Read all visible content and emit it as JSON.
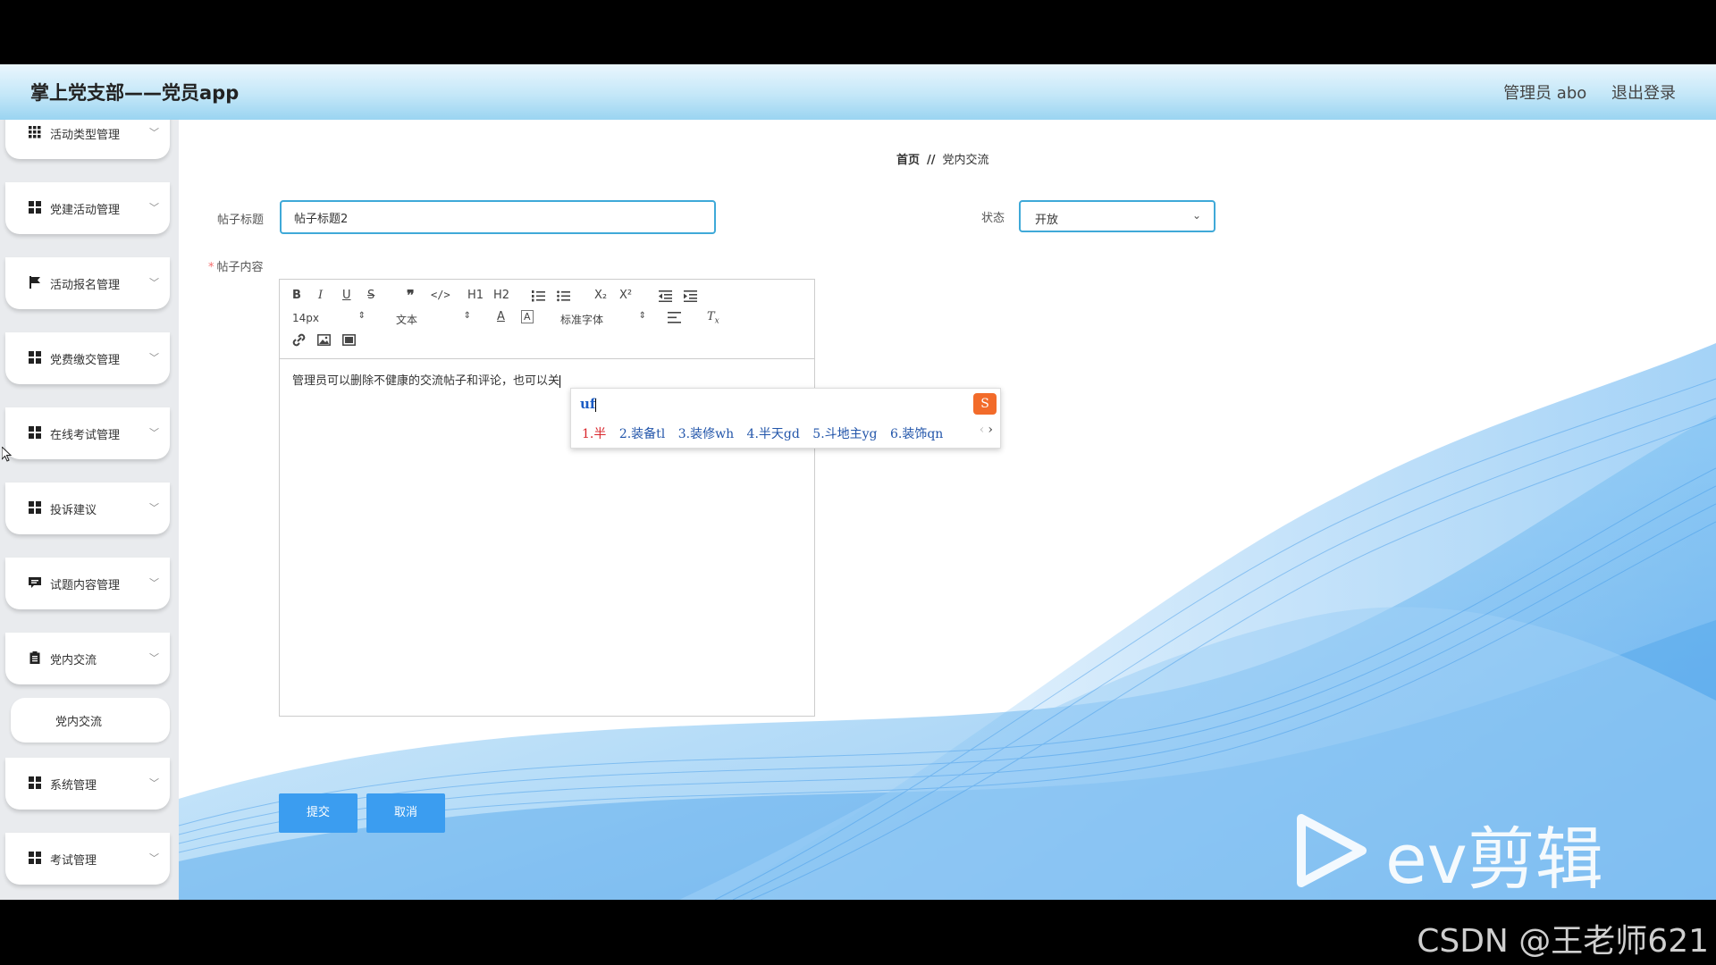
{
  "header": {
    "app_title": "掌上党支部——党员app",
    "user": "管理员 abo",
    "logout": "退出登录"
  },
  "sidebar": {
    "items": [
      {
        "label": "活动类型管理",
        "icon": "grid-icon"
      },
      {
        "label": "党建活动管理",
        "icon": "grid-icon"
      },
      {
        "label": "活动报名管理",
        "icon": "flag-icon"
      },
      {
        "label": "党费缴交管理",
        "icon": "grid-icon"
      },
      {
        "label": "在线考试管理",
        "icon": "grid-icon"
      },
      {
        "label": "投诉建议",
        "icon": "grid-icon"
      },
      {
        "label": "试题内容管理",
        "icon": "comment-icon"
      },
      {
        "label": "党内交流",
        "icon": "clipboard-icon"
      },
      {
        "label": "系统管理",
        "icon": "grid-icon"
      },
      {
        "label": "考试管理",
        "icon": "grid-icon"
      }
    ],
    "active_sub": "党内交流"
  },
  "breadcrumb": {
    "home": "首页",
    "sep": "//",
    "current": "党内交流"
  },
  "form": {
    "title_label": "帖子标题",
    "title_value": "帖子标题2",
    "status_label": "状态",
    "status_value": "开放",
    "content_label": "帖子内容",
    "required_mark": "*",
    "content_text": "管理员可以删除不健康的交流帖子和评论，也可以关"
  },
  "toolbar": {
    "font_size": "14px",
    "header_select": "文本",
    "font_family": "标准字体",
    "h1": "H1",
    "h2": "H2"
  },
  "ime": {
    "input": "uf",
    "candidates": [
      "1.半",
      "2.装备tl",
      "3.装修wh",
      "4.半天gd",
      "5.斗地主yg",
      "6.装饰qn"
    ]
  },
  "buttons": {
    "submit": "提交",
    "cancel": "取消"
  },
  "watermark": {
    "ev": "ev剪辑",
    "csdn": "CSDN @王老师621"
  },
  "colors": {
    "accent": "#3b9df0",
    "border": "#3fa9d8",
    "header_bg": "#c4e7f8"
  }
}
